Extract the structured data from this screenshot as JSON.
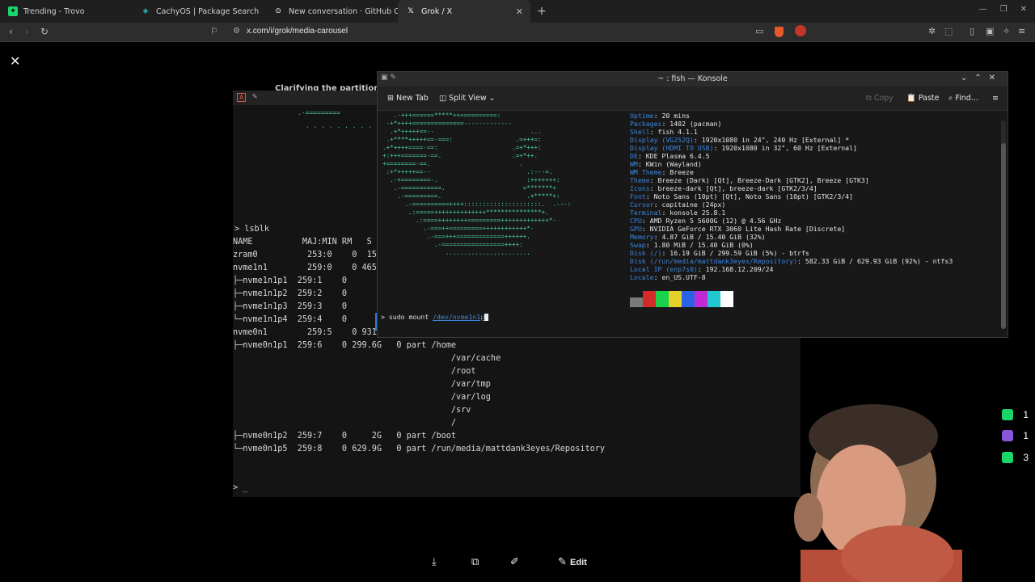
{
  "browser": {
    "tabs": [
      {
        "label": "Trending - Trovo",
        "icon": "trovo-icon",
        "color": "#19d66b"
      },
      {
        "label": "CachyOS | Package Search",
        "icon": "cachyos-icon",
        "color": "#29c4c4"
      },
      {
        "label": "New conversation · GitHub Copilot",
        "icon": "github-icon",
        "color": "#ffffff"
      },
      {
        "label": "Grok / X",
        "icon": "x-icon",
        "color": "#ffffff",
        "active": true
      }
    ],
    "url": "x.com/i/grok/media-carousel"
  },
  "background_terminal": {
    "title_fragment": "Clarifying the partition n",
    "top_fragment": ".-=========",
    "dots_fragment": ". . . . . . . . . . .",
    "prompt_cmd": "lsblk",
    "prompt_symbol": ">",
    "header": "NAME          MAJ:MIN RM   S",
    "rows": [
      "zram0          253:0    0  15",
      "nvme1n1        259:0    0 465",
      "├─nvme1n1p1  259:1    0",
      "├─nvme1n1p2  259:2    0",
      "├─nvme1n1p3  259:3    0",
      "└─nvme1n1p4  259:4    0",
      "nvme0n1        259:5    0 931",
      "├─nvme0n1p1  259:6    0 299.6G   0 part /home",
      "                                            /var/cache",
      "                                            /root",
      "                                            /var/tmp",
      "                                            /var/log",
      "                                            /srv",
      "                                            /",
      "├─nvme0n1p2  259:7    0     2G   0 part /boot",
      "└─nvme0n1p5  259:8    0 629.9G   0 part /run/media/mattdank3eyes/Repository"
    ],
    "final_prompt": "> _"
  },
  "konsole": {
    "title": "~ : fish — Konsole",
    "toolbar": {
      "new_tab": "New Tab",
      "split_view": "Split View",
      "copy": "Copy",
      "paste": "Paste",
      "find": "Find..."
    },
    "fastfetch": [
      {
        "k": "Uptime",
        "v": "20 mins"
      },
      {
        "k": "Packages",
        "v": "1402 (pacman)"
      },
      {
        "k": "Shell",
        "v": "fish 4.1.1"
      },
      {
        "k": "Display (VG252Q)",
        "v": "1920x1080 in 24\", 240 Hz [External] *"
      },
      {
        "k": "Display (HDMI TO USB)",
        "v": "1920x1080 in 32\", 60 Hz [External]"
      },
      {
        "k": "DE",
        "v": "KDE Plasma 6.4.5"
      },
      {
        "k": "WM",
        "v": "KWin (Wayland)"
      },
      {
        "k": "WM Theme",
        "v": "Breeze"
      },
      {
        "k": "Theme",
        "v": "Breeze (Dark) [Qt], Breeze-Dark [GTK2], Breeze [GTK3]"
      },
      {
        "k": "Icons",
        "v": "breeze-dark [Qt], breeze-dark [GTK2/3/4]"
      },
      {
        "k": "Font",
        "v": "Noto Sans (10pt) [Qt], Noto Sans (10pt) [GTK2/3/4]"
      },
      {
        "k": "Cursor",
        "v": "capitaine (24px)"
      },
      {
        "k": "Terminal",
        "v": "konsole 25.8.1"
      },
      {
        "k": "CPU",
        "v": "AMD Ryzen 5 5600G (12) @ 4.56 GHz"
      },
      {
        "k": "GPU",
        "v": "NVIDIA GeForce RTX 3060 Lite Hash Rate [Discrete]"
      },
      {
        "k": "Memory",
        "v": "4.87 GiB / 15.40 GiB (32%)"
      },
      {
        "k": "Swap",
        "v": "1.80 MiB / 15.40 GiB (0%)"
      },
      {
        "k": "Disk (/)",
        "v": "16.19 GiB / 299.59 GiB (5%) - btrfs"
      },
      {
        "k": "Disk (/run/media/mattdank3eyes/Repository)",
        "v": "582.33 GiB / 629.93 GiB (92%) - ntfs3"
      },
      {
        "k": "Local IP (enp7s0)",
        "v": "192.168.12.209/24"
      },
      {
        "k": "Locale",
        "v": "en_US.UTF-8"
      }
    ],
    "palette": [
      "#7a7a7a",
      "#d42a2a",
      "#19d14a",
      "#e6d02a",
      "#2a62e6",
      "#c02ad4",
      "#22c6d0",
      "#ffffff"
    ],
    "prompt_cmd": "sudo mount",
    "prompt_path": "/dev/nvme1n1p",
    "prompt_symbol": ">"
  },
  "media_bar": {
    "edit_label": "Edit"
  },
  "overlay": {
    "counts": [
      {
        "value": "1",
        "color": "#19d66b",
        "icon": "trovo-icon"
      },
      {
        "value": "1",
        "color": "#8a55d8",
        "icon": "twitch-icon"
      },
      {
        "value": "3",
        "color": "#19d66b",
        "icon": "kick-icon"
      }
    ]
  }
}
